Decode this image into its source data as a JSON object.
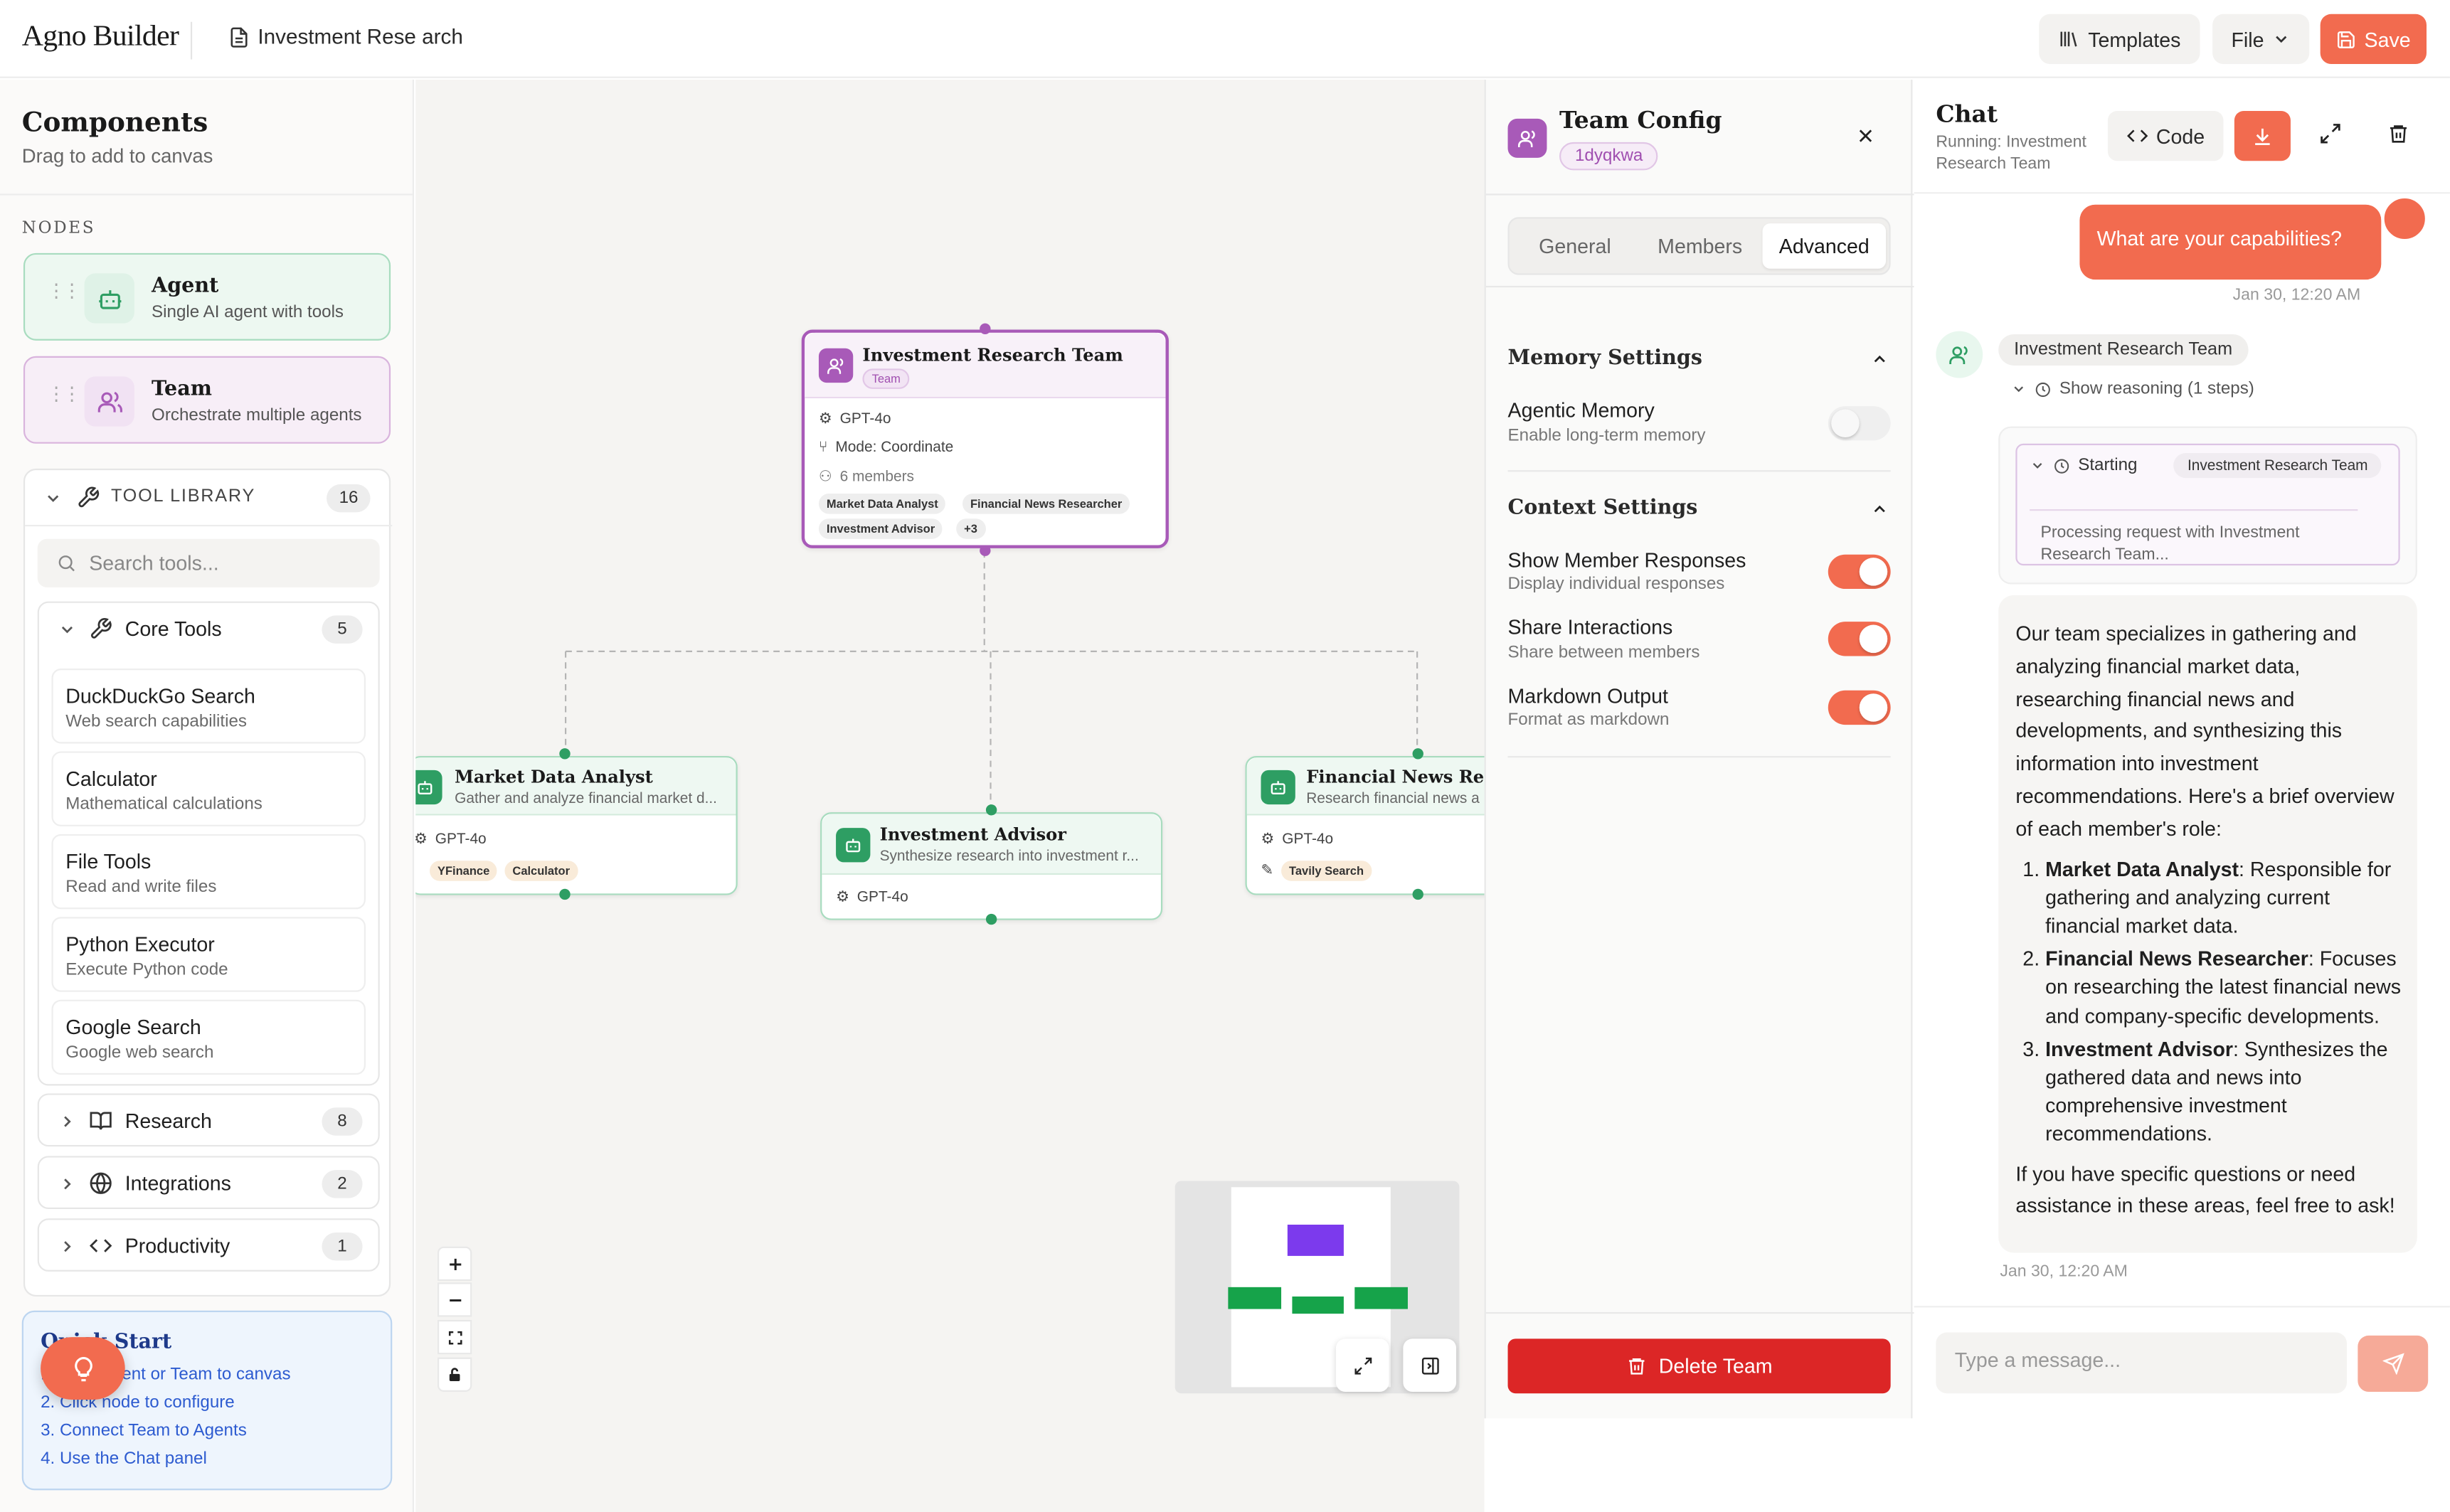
{
  "header": {
    "logo": "Agno Builder",
    "doc_title": "Investment Rese arch",
    "templates_label": "Templates",
    "file_label": "File",
    "save_label": "Save"
  },
  "sidebar": {
    "title": "Components",
    "subtitle": "Drag to add to canvas",
    "nodes_label": "NODES",
    "nodes": [
      {
        "name": "Agent",
        "desc": "Single AI agent with tools"
      },
      {
        "name": "Team",
        "desc": "Orchestrate multiple agents"
      }
    ],
    "tool_library": {
      "title": "TOOL LIBRARY",
      "count": "16",
      "search_placeholder": "Search tools...",
      "core": {
        "name": "Core Tools",
        "count": "5",
        "tools": [
          {
            "name": "DuckDuckGo Search",
            "desc": "Web search capabilities"
          },
          {
            "name": "Calculator",
            "desc": "Mathematical calculations"
          },
          {
            "name": "File Tools",
            "desc": "Read and write files"
          },
          {
            "name": "Python Executor",
            "desc": "Execute Python code"
          },
          {
            "name": "Google Search",
            "desc": "Google web search"
          }
        ]
      },
      "categories": [
        {
          "name": "Research",
          "count": "8"
        },
        {
          "name": "Integrations",
          "count": "2"
        },
        {
          "name": "Productivity",
          "count": "1"
        }
      ]
    },
    "quick_start": {
      "title": "Quick Start",
      "steps": [
        "1. Drag Agent or Team to canvas",
        "2. Click node to configure",
        "3. Connect Team to Agents",
        "4. Use the Chat panel"
      ]
    }
  },
  "canvas": {
    "team_node": {
      "title": "Investment Research Team",
      "tag": "Team",
      "model": "GPT-4o",
      "mode": "Mode: Coordinate",
      "members": "6 members",
      "chips": [
        "Market Data Analyst",
        "Financial News Researcher",
        "Investment Advisor",
        "+3"
      ]
    },
    "agents": [
      {
        "title": "Market Data Analyst",
        "desc": "Gather and analyze financial market d...",
        "model": "GPT-4o",
        "tools": [
          "YFinance",
          "Calculator"
        ]
      },
      {
        "title": "Investment Advisor",
        "desc": "Synthesize research into investment r...",
        "model": "GPT-4o",
        "tools": []
      },
      {
        "title": "Financial News Researcher",
        "desc": "Research financial news a",
        "model": "GPT-4o",
        "tools": [
          "Tavily Search"
        ]
      }
    ]
  },
  "config": {
    "title": "Team Config",
    "id": "1dyqkwa",
    "tabs": [
      "General",
      "Members",
      "Advanced"
    ],
    "active_tab": "Advanced",
    "memory_section": "Memory Settings",
    "agentic_memory": {
      "name": "Agentic Memory",
      "desc": "Enable long-term memory",
      "on": false
    },
    "context_section": "Context Settings",
    "settings": [
      {
        "name": "Show Member Responses",
        "desc": "Display individual responses",
        "on": true
      },
      {
        "name": "Share Interactions",
        "desc": "Share between members",
        "on": true
      },
      {
        "name": "Markdown Output",
        "desc": "Format as markdown",
        "on": true
      }
    ],
    "delete_label": "Delete Team"
  },
  "chat": {
    "title": "Chat",
    "subtitle": "Running: Investment Research Team",
    "code_label": "Code",
    "user_message": "What are your capabilities?",
    "user_time": "Jan 30, 12:20 AM",
    "bot_name": "Investment Research Team",
    "reasoning_label": "Show reasoning (1 steps)",
    "reasoning": {
      "status": "Starting",
      "agent": "Investment Research Team",
      "text": "Processing request with Investment Research Team..."
    },
    "response": {
      "intro": "Our team specializes in gathering and analyzing financial market data, researching financial news and developments, and synthesizing this information into investment recommendations. Here's a brief overview of each member's role:",
      "items": [
        {
          "name": "Market Data Analyst",
          "text": ": Responsible for gathering and analyzing current financial market data."
        },
        {
          "name": "Financial News Researcher",
          "text": ": Focuses on researching the latest financial news and company-specific developments."
        },
        {
          "name": "Investment Advisor",
          "text": ": Synthesizes the gathered data and news into comprehensive investment recommendations."
        }
      ],
      "outro": "If you have specific questions or need assistance in these areas, feel free to ask!"
    },
    "bot_time": "Jan 30, 12:20 AM",
    "input_placeholder": "Type a message..."
  },
  "colors": {
    "accent": "#f26b4f",
    "team_purple": "#a85ab8",
    "agent_green": "#2e9e63",
    "danger": "#dc2626"
  }
}
